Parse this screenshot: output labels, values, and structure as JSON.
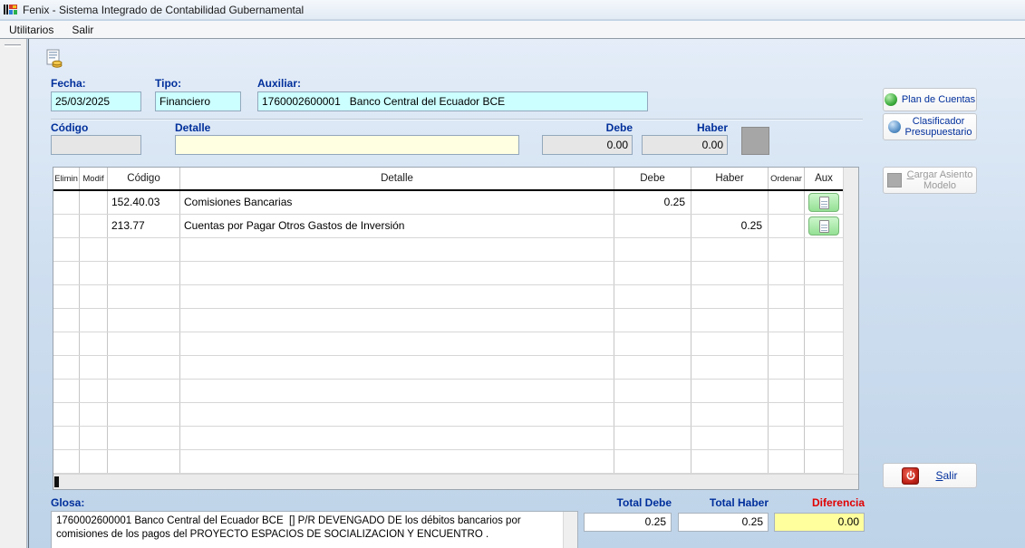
{
  "window": {
    "title": "Fenix - Sistema Integrado de Contabilidad Gubernamental",
    "menu": [
      {
        "label": "Utilitarios"
      },
      {
        "label": "Salir"
      }
    ]
  },
  "form": {
    "fecha_label": "Fecha:",
    "fecha_value": "25/03/2025",
    "tipo_label": "Tipo:",
    "tipo_value": "Financiero",
    "auxiliar_label": "Auxiliar:",
    "auxiliar_value": "1760002600001   Banco Central del Ecuador BCE",
    "codigo_label": "Código",
    "codigo_value": "",
    "detalle_label": "Detalle",
    "detalle_value": "",
    "debe_label": "Debe",
    "debe_value": "0.00",
    "haber_label": "Haber",
    "haber_value": "0.00"
  },
  "grid": {
    "columns": [
      "Elimin",
      "Modif",
      "Código",
      "Detalle",
      "Debe",
      "Haber",
      "Ordenar",
      "Aux"
    ],
    "rows": [
      {
        "codigo": "152.40.03",
        "detalle": "Comisiones Bancarias",
        "debe": "0.25",
        "haber": ""
      },
      {
        "codigo": "213.77",
        "detalle": "Cuentas por Pagar Otros Gastos de Inversión",
        "debe": "",
        "haber": "0.25"
      }
    ],
    "empty_rows": 10
  },
  "side_buttons": {
    "plan_de_cuentas": "Plan de Cuentas",
    "clasificador_line1": "Clasificador",
    "clasificador_line2": "Presupuestario",
    "cargar_accel": "C",
    "cargar_rest": "argar Asiento",
    "cargar_line2": "Modelo",
    "salir_accel": "S",
    "salir_rest": "alir"
  },
  "footer": {
    "glosa_label": "Glosa:",
    "glosa_text": "1760002600001 Banco Central del Ecuador BCE  [] P/R DEVENGADO DE los débitos bancarios por comisiones de los pagos del PROYECTO ESPACIOS DE SOCIALIZACION Y ENCUENTRO .",
    "total_debe_label": "Total Debe",
    "total_debe_value": "0.25",
    "total_haber_label": "Total Haber",
    "total_haber_value": "0.25",
    "diferencia_label": "Diferencia",
    "diferencia_value": "0.00"
  },
  "colors": {
    "label_navy": "#002f9b",
    "field_cyan": "#ccffff",
    "field_ivory": "#ffffe1",
    "diferencia_red": "#e00000",
    "diferencia_yellow": "#ffff9e",
    "aux_green": "#94e094"
  }
}
